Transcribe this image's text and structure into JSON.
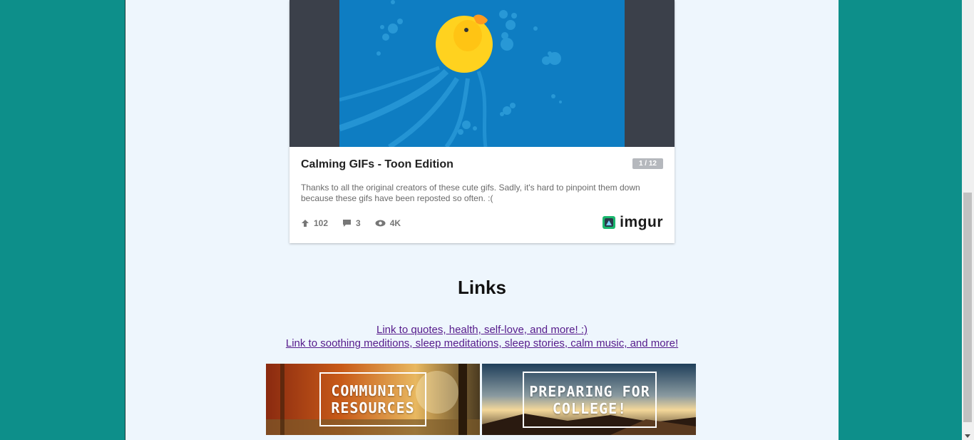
{
  "embed": {
    "title": "Calming GIFs - Toon Edition",
    "pager": "1 / 12",
    "description": "Thanks to all the original creators of these cute gifs. Sadly, it's hard to pinpoint them down because these gifs have been reposted so often. :(",
    "stats": {
      "upvotes": "102",
      "comments": "3",
      "views": "4K"
    },
    "brand": "imgur"
  },
  "links": {
    "heading": "Links",
    "items": [
      "Link to quotes, health, self-love, and more! :)",
      "Link to soothing meditions, sleep meditations, sleep stories, calm music, and more!"
    ]
  },
  "banners": [
    {
      "line1": "COMMUNITY",
      "line2": "RESOURCES"
    },
    {
      "line1": "PREPARING FOR",
      "line2": "COLLEGE!"
    }
  ],
  "colors": {
    "outer_background": "#0d8f8a",
    "page_background": "#eef6fd",
    "link": "#551a8b",
    "water": "#0e7dc2",
    "duck": "#ffd21f"
  }
}
